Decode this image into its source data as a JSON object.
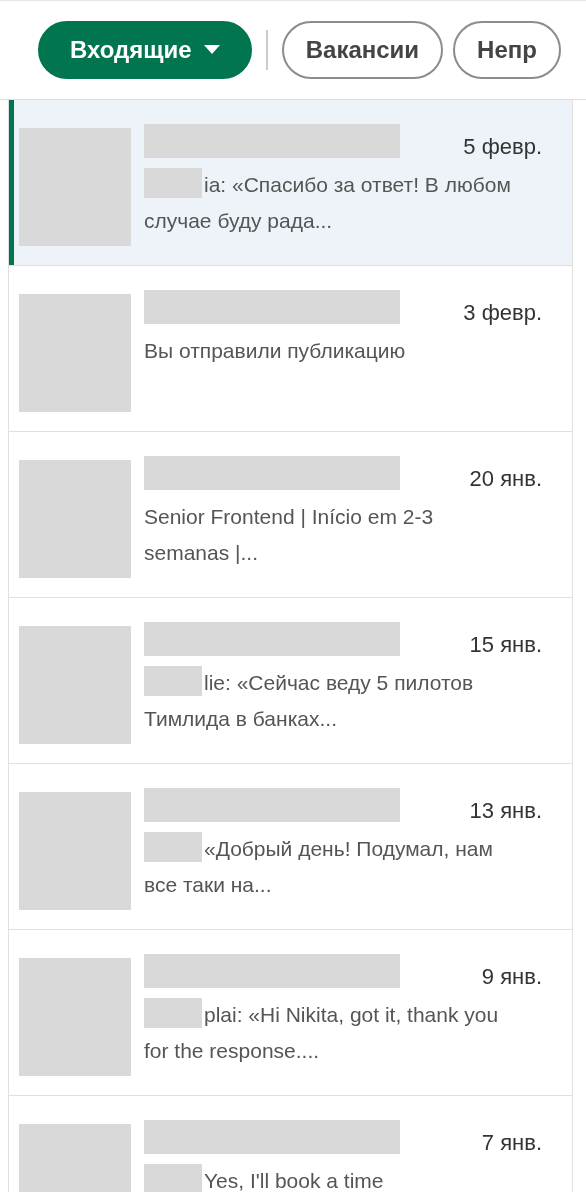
{
  "filters": [
    {
      "label": "Входящие",
      "selected": true,
      "has_caret": true
    },
    {
      "label": "Вакансии",
      "selected": false,
      "has_caret": false
    },
    {
      "label": "Непр",
      "selected": false,
      "has_caret": false
    }
  ],
  "conversations": [
    {
      "date": "5 февр.",
      "snippet": "ia: «Спасибо за ответ! В любом случае буду рада...",
      "snippet_redacted": true,
      "selected": true
    },
    {
      "date": "3 февр.",
      "snippet": "Вы отправили публикацию",
      "snippet_redacted": false,
      "selected": false
    },
    {
      "date": "20 янв.",
      "snippet": "Senior Frontend | Início em 2-3 semanas |...",
      "snippet_redacted": false,
      "selected": false
    },
    {
      "date": "15 янв.",
      "snippet": "lie: «Сейчас веду 5 пилотов Тимлида в банках...",
      "snippet_redacted": true,
      "selected": false
    },
    {
      "date": "13 янв.",
      "snippet": "«Добрый день! Подумал, нам все таки на...",
      "snippet_redacted": true,
      "selected": false
    },
    {
      "date": "9 янв.",
      "snippet": "plai: «Hi Nikita, got it, thank you for the response....",
      "snippet_redacted": true,
      "selected": false
    },
    {
      "date": "7 янв.",
      "snippet": "Yes, I'll book a time",
      "snippet_redacted": true,
      "selected": false
    }
  ]
}
